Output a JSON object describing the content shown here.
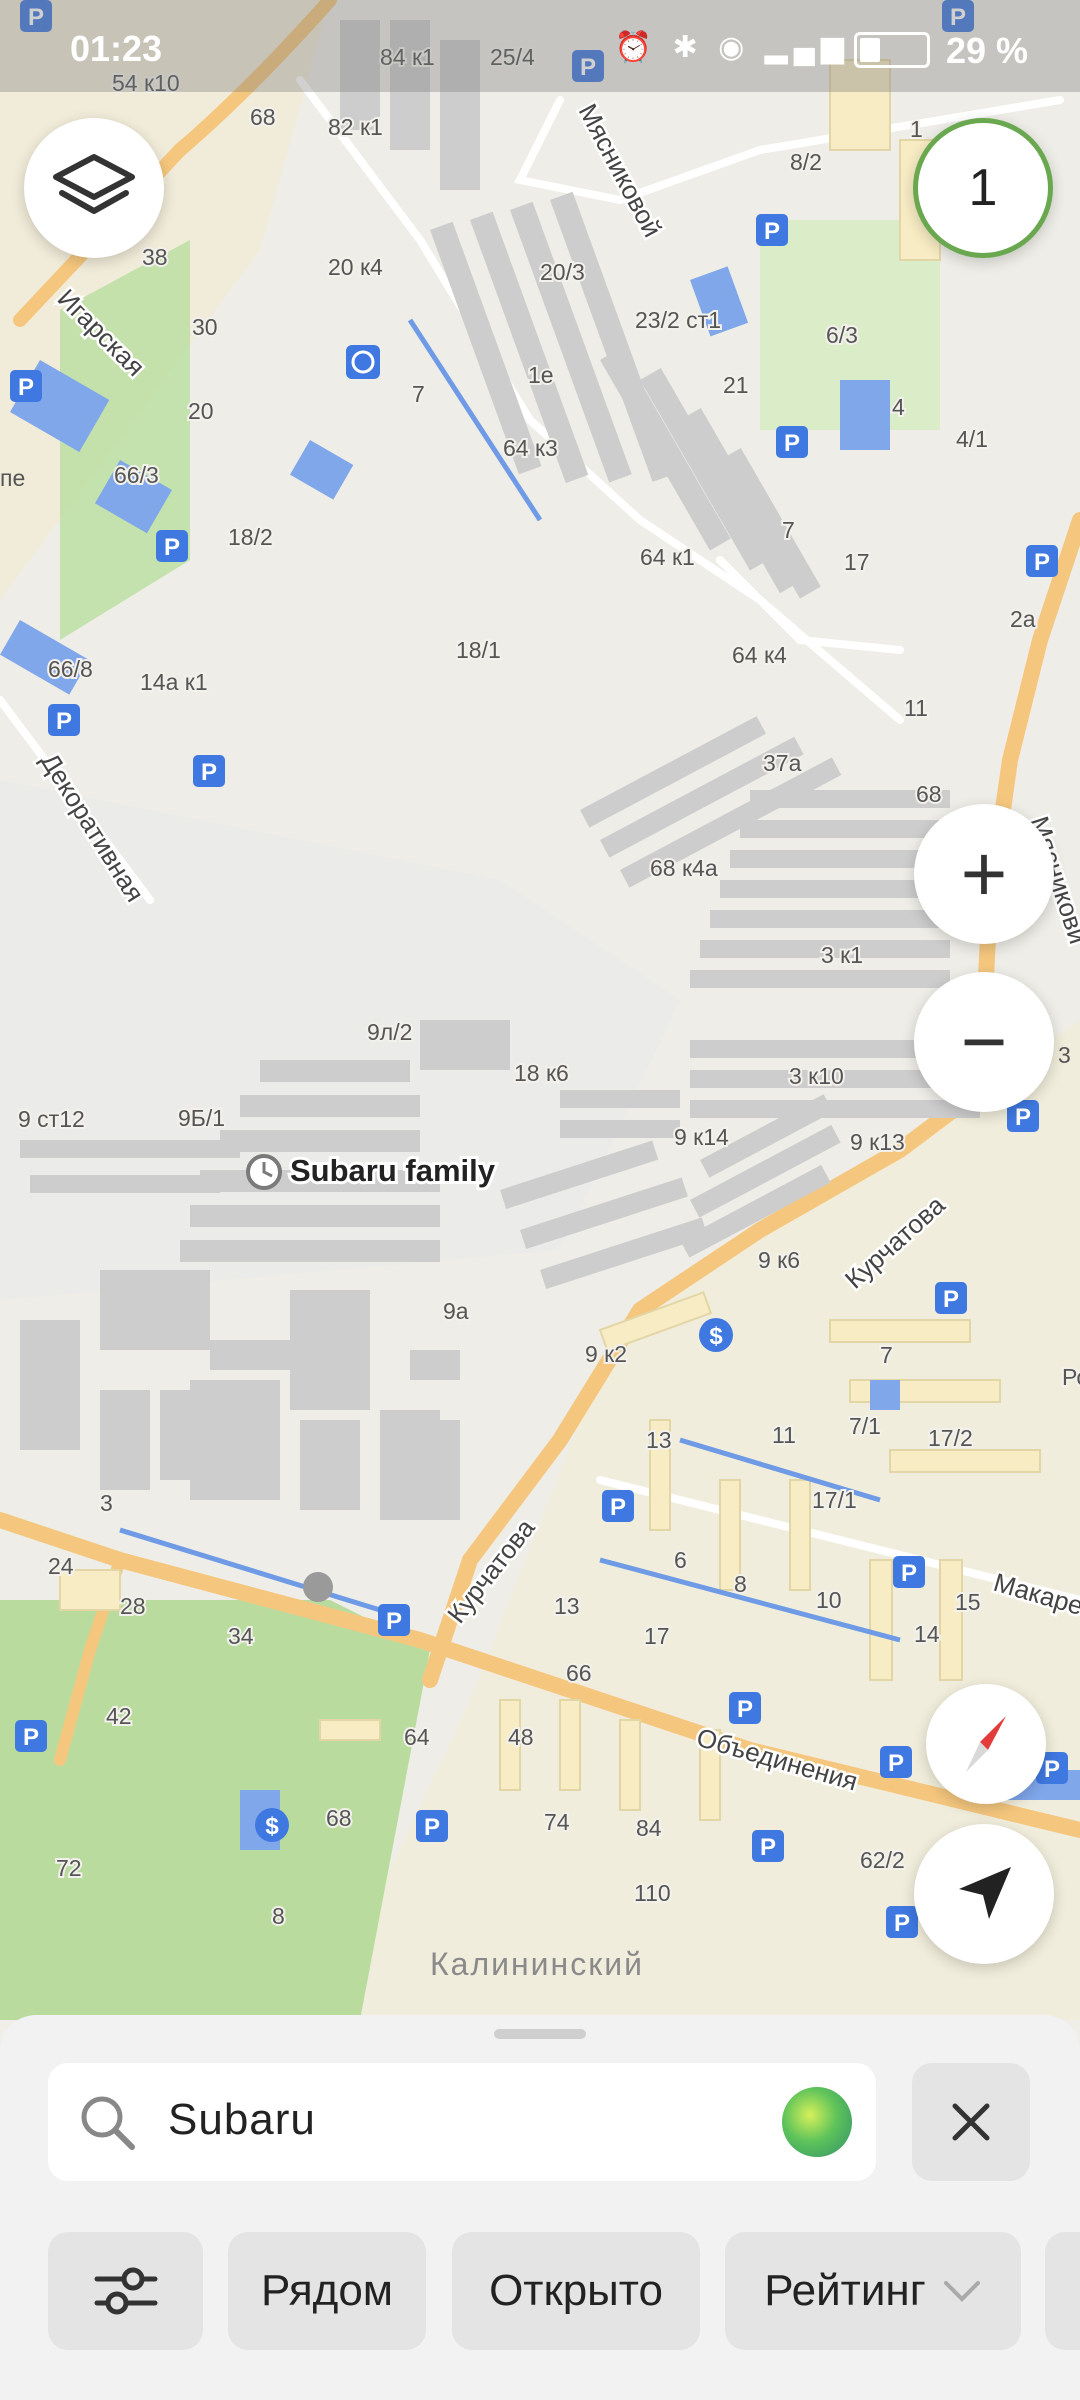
{
  "status_bar": {
    "time": "01:23",
    "battery": "29 %"
  },
  "map": {
    "poi_name": "Subaru family",
    "district_label": "Калининский",
    "streets": [
      "Мясниковой",
      "Игарская",
      "Декоративная",
      "Курчатова",
      "Курчатова",
      "Объединения",
      "Макаре",
      "Мясникови"
    ],
    "house_numbers": [
      "84 к1",
      "25/4",
      "82 к1",
      "54 к10",
      "68",
      "20 к4",
      "20/3",
      "38",
      "30",
      "23/2 ст1",
      "8/2",
      "6/3",
      "21",
      "4",
      "4/1",
      "1е",
      "7",
      "64 к3",
      "20",
      "66/3",
      "18/2",
      "7",
      "17",
      "64 к1",
      "66/8",
      "14а к1",
      "18/1",
      "64 к4",
      "2а",
      "11",
      "37а",
      "68",
      "68 к4а",
      "3 к1",
      "9л/2",
      "18 к6",
      "3 к10",
      "9 ст12",
      "9Б/1",
      "9 к14",
      "9 к13",
      "9 к6",
      "9а",
      "9 к2",
      "7",
      "13",
      "11",
      "7/1",
      "17/2",
      "3",
      "17/1",
      "24",
      "28",
      "34",
      "6",
      "8",
      "13",
      "10",
      "17",
      "14",
      "15",
      "66",
      "42",
      "64",
      "48",
      "68",
      "74",
      "84",
      "62/2",
      "72",
      "110",
      "8",
      "1",
      "Род"
    ],
    "ab_partial": [
      "пе",
      "6",
      "3"
    ]
  },
  "controls": {
    "layers_icon": "layers-icon",
    "notification_count": "1",
    "zoom_in": "+",
    "zoom_out": "−"
  },
  "search": {
    "query": "Subaru"
  },
  "filters": {
    "nearby": "Рядом",
    "open": "Открыто",
    "rating": "Рейтинг"
  },
  "colors": {
    "road": "#f5c77e",
    "building": "#cfcfcf",
    "park": "#b8dd9c",
    "water_blue": "#5f8fe0",
    "parking": "#3f78e0",
    "accent_green": "#6aa84f"
  }
}
